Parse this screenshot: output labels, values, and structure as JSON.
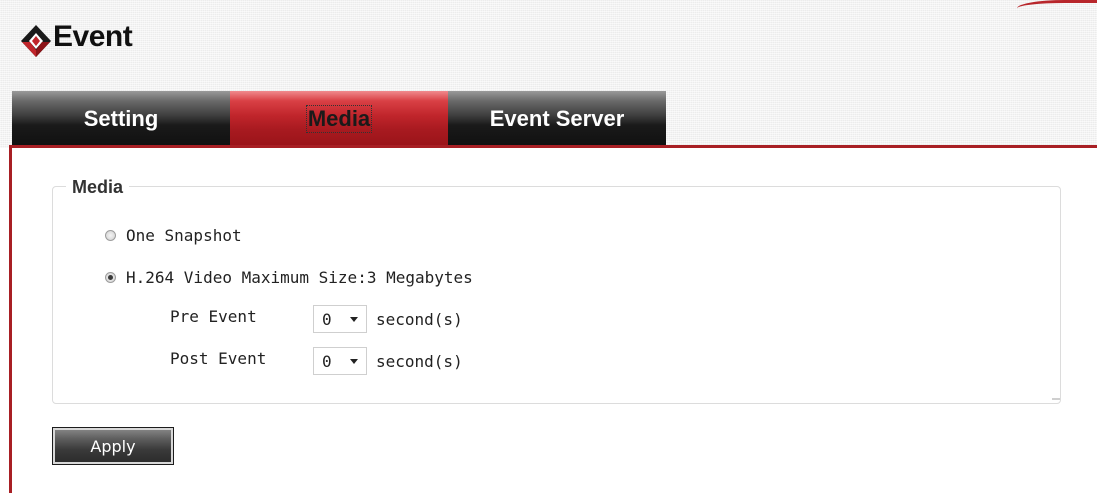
{
  "header": {
    "title": "Event",
    "logo_icon": "diamond-logo-icon",
    "accent_color": "#b8262b"
  },
  "tabs": [
    {
      "label": "Setting",
      "active": false
    },
    {
      "label": "Media",
      "active": true
    },
    {
      "label": "Event Server",
      "active": false
    }
  ],
  "media": {
    "legend": "Media",
    "options": [
      {
        "label": "One Snapshot",
        "checked": false
      },
      {
        "label": "H.264 Video Maximum Size:3 Megabytes",
        "checked": true
      }
    ],
    "pre_event": {
      "label": "Pre Event",
      "value": "0",
      "unit": "second(s)"
    },
    "post_event": {
      "label": "Post Event",
      "value": "0",
      "unit": "second(s)"
    }
  },
  "apply_label": "Apply"
}
